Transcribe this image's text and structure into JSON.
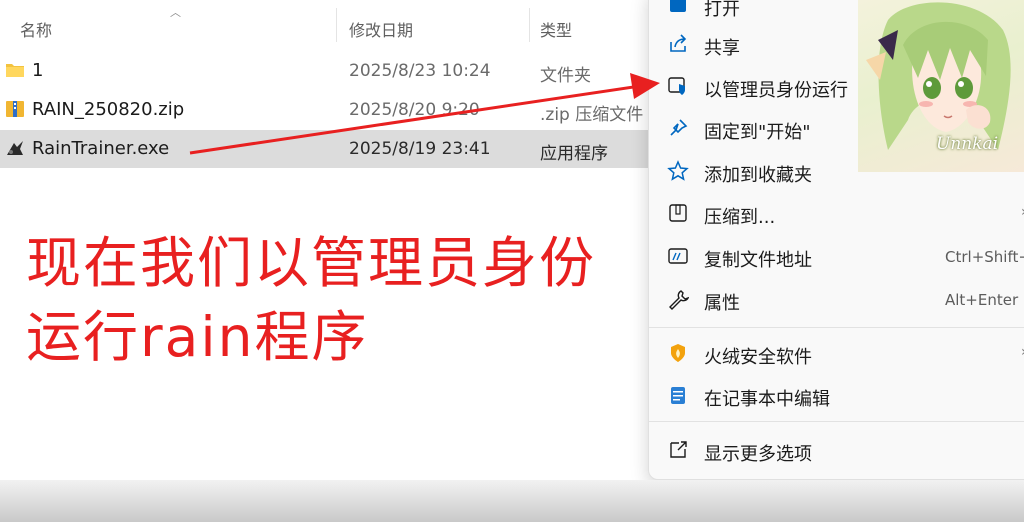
{
  "columns": {
    "name": "名称",
    "date": "修改日期",
    "type": "类型"
  },
  "files": [
    {
      "name": "1",
      "date": "2025/8/23 10:24",
      "type": "文件夹",
      "icon": "folder-icon"
    },
    {
      "name": "RAIN_250820.zip",
      "date": "2025/8/20 9:20",
      "type": ".zip 压缩文件",
      "icon": "zip-icon"
    },
    {
      "name": "RainTrainer.exe",
      "date": "2025/8/19 23:41",
      "type": "应用程序",
      "icon": "app-icon",
      "selected": true
    }
  ],
  "caption": {
    "line1": "现在我们以管理员身份",
    "line2": "运行rain程序",
    "color": "#e82020"
  },
  "context_menu": {
    "items": [
      {
        "label": "打开",
        "icon": "open-icon"
      },
      {
        "label": "共享",
        "icon": "share-icon"
      },
      {
        "label": "以管理员身份运行",
        "icon": "shield-icon"
      },
      {
        "label": "固定到\"开始\"",
        "icon": "pin-icon"
      },
      {
        "label": "添加到收藏夹",
        "icon": "star-icon"
      },
      {
        "label": "压缩到...",
        "icon": "zip-folder-icon",
        "submenu": true
      },
      {
        "label": "复制文件地址",
        "icon": "copy-path-icon",
        "shortcut": "Ctrl+Shift+C"
      },
      {
        "label": "属性",
        "icon": "wrench-icon",
        "shortcut": "Alt+Enter"
      },
      {
        "label": "火绒安全软件",
        "icon": "huorong-icon",
        "submenu": true
      },
      {
        "label": "在记事本中编辑",
        "icon": "notepad-icon"
      },
      {
        "label": "显示更多选项",
        "icon": "more-options-icon"
      }
    ]
  },
  "avatar": {
    "name": "Unnkai"
  },
  "accent_color": "#0067c0",
  "annotation_color": "#e82020"
}
